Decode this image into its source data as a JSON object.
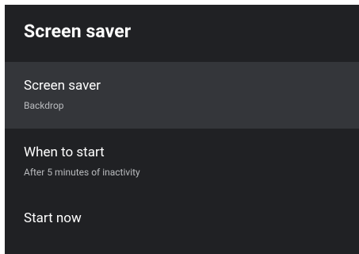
{
  "header": {
    "title": "Screen saver"
  },
  "settings": {
    "items": [
      {
        "label": "Screen saver",
        "value": "Backdrop"
      },
      {
        "label": "When to start",
        "value": "After 5 minutes of inactivity"
      },
      {
        "label": "Start now"
      }
    ]
  },
  "colors": {
    "panel_background": "#202124",
    "selected_row_background": "#34363a",
    "primary_text": "#ffffff",
    "secondary_text": "#b9bbbe"
  }
}
